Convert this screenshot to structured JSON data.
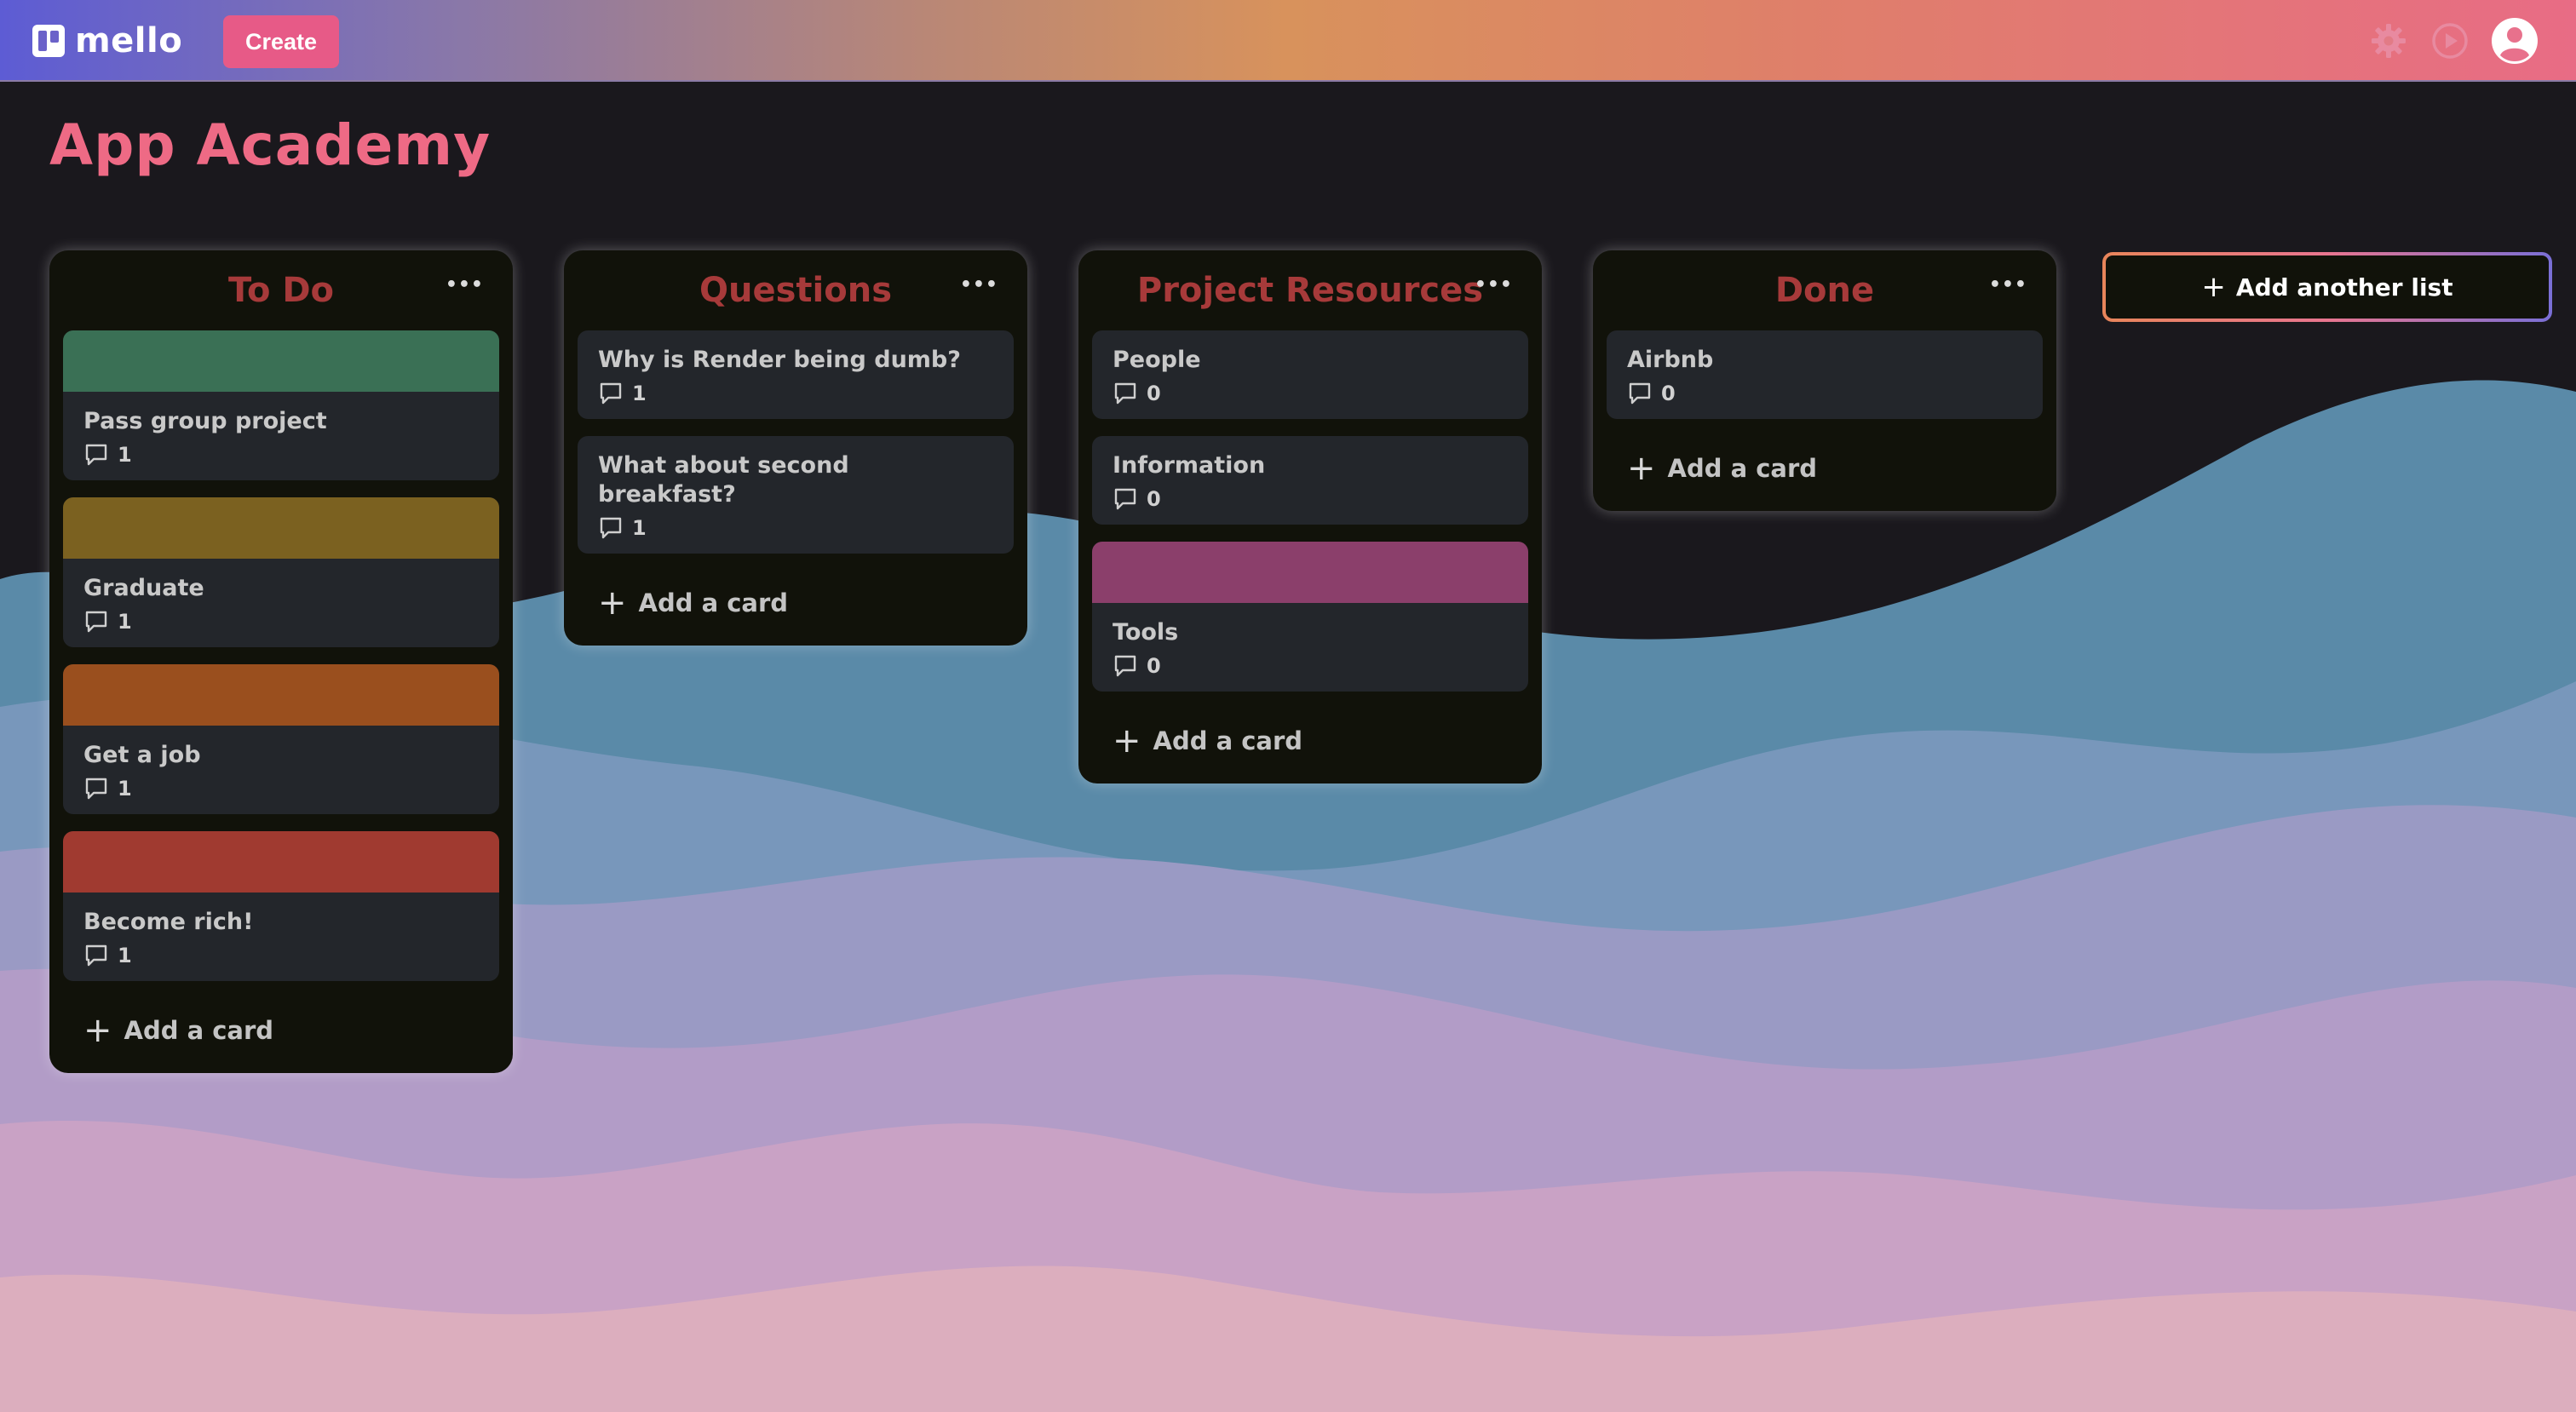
{
  "app": {
    "brand": "mello",
    "create_label": "Create"
  },
  "header_icons": [
    "gear-icon",
    "play-icon",
    "user-avatar-icon"
  ],
  "board": {
    "title": "App Academy",
    "add_list_label": "Add another list",
    "add_card_label": "Add a card",
    "menu_glyph": "•••",
    "lists": [
      {
        "title": "To Do",
        "cards": [
          {
            "title": "Pass group project",
            "comments": "1",
            "cover": "#3a7055"
          },
          {
            "title": "Graduate",
            "comments": "1",
            "cover": "#7b6120"
          },
          {
            "title": "Get a job",
            "comments": "1",
            "cover": "#9a4f1e"
          },
          {
            "title": "Become rich!",
            "comments": "1",
            "cover": "#a03a30"
          }
        ]
      },
      {
        "title": "Questions",
        "cards": [
          {
            "title": "Why is Render being dumb?",
            "comments": "1"
          },
          {
            "title": "What about second breakfast?",
            "comments": "1"
          }
        ]
      },
      {
        "title": "Project Resources",
        "cards": [
          {
            "title": "People",
            "comments": "0"
          },
          {
            "title": "Information",
            "comments": "0"
          },
          {
            "title": "Tools",
            "comments": "0",
            "cover": "#8b3f6b"
          }
        ]
      },
      {
        "title": "Done",
        "cards": [
          {
            "title": "Airbnb",
            "comments": "0"
          }
        ]
      }
    ]
  },
  "colors": {
    "title_pink": "#ee6a85",
    "list_title_red": "#a73a3a",
    "list_bg": "#11120a",
    "card_bg": "#23262b",
    "create_button": "#e75a87"
  }
}
